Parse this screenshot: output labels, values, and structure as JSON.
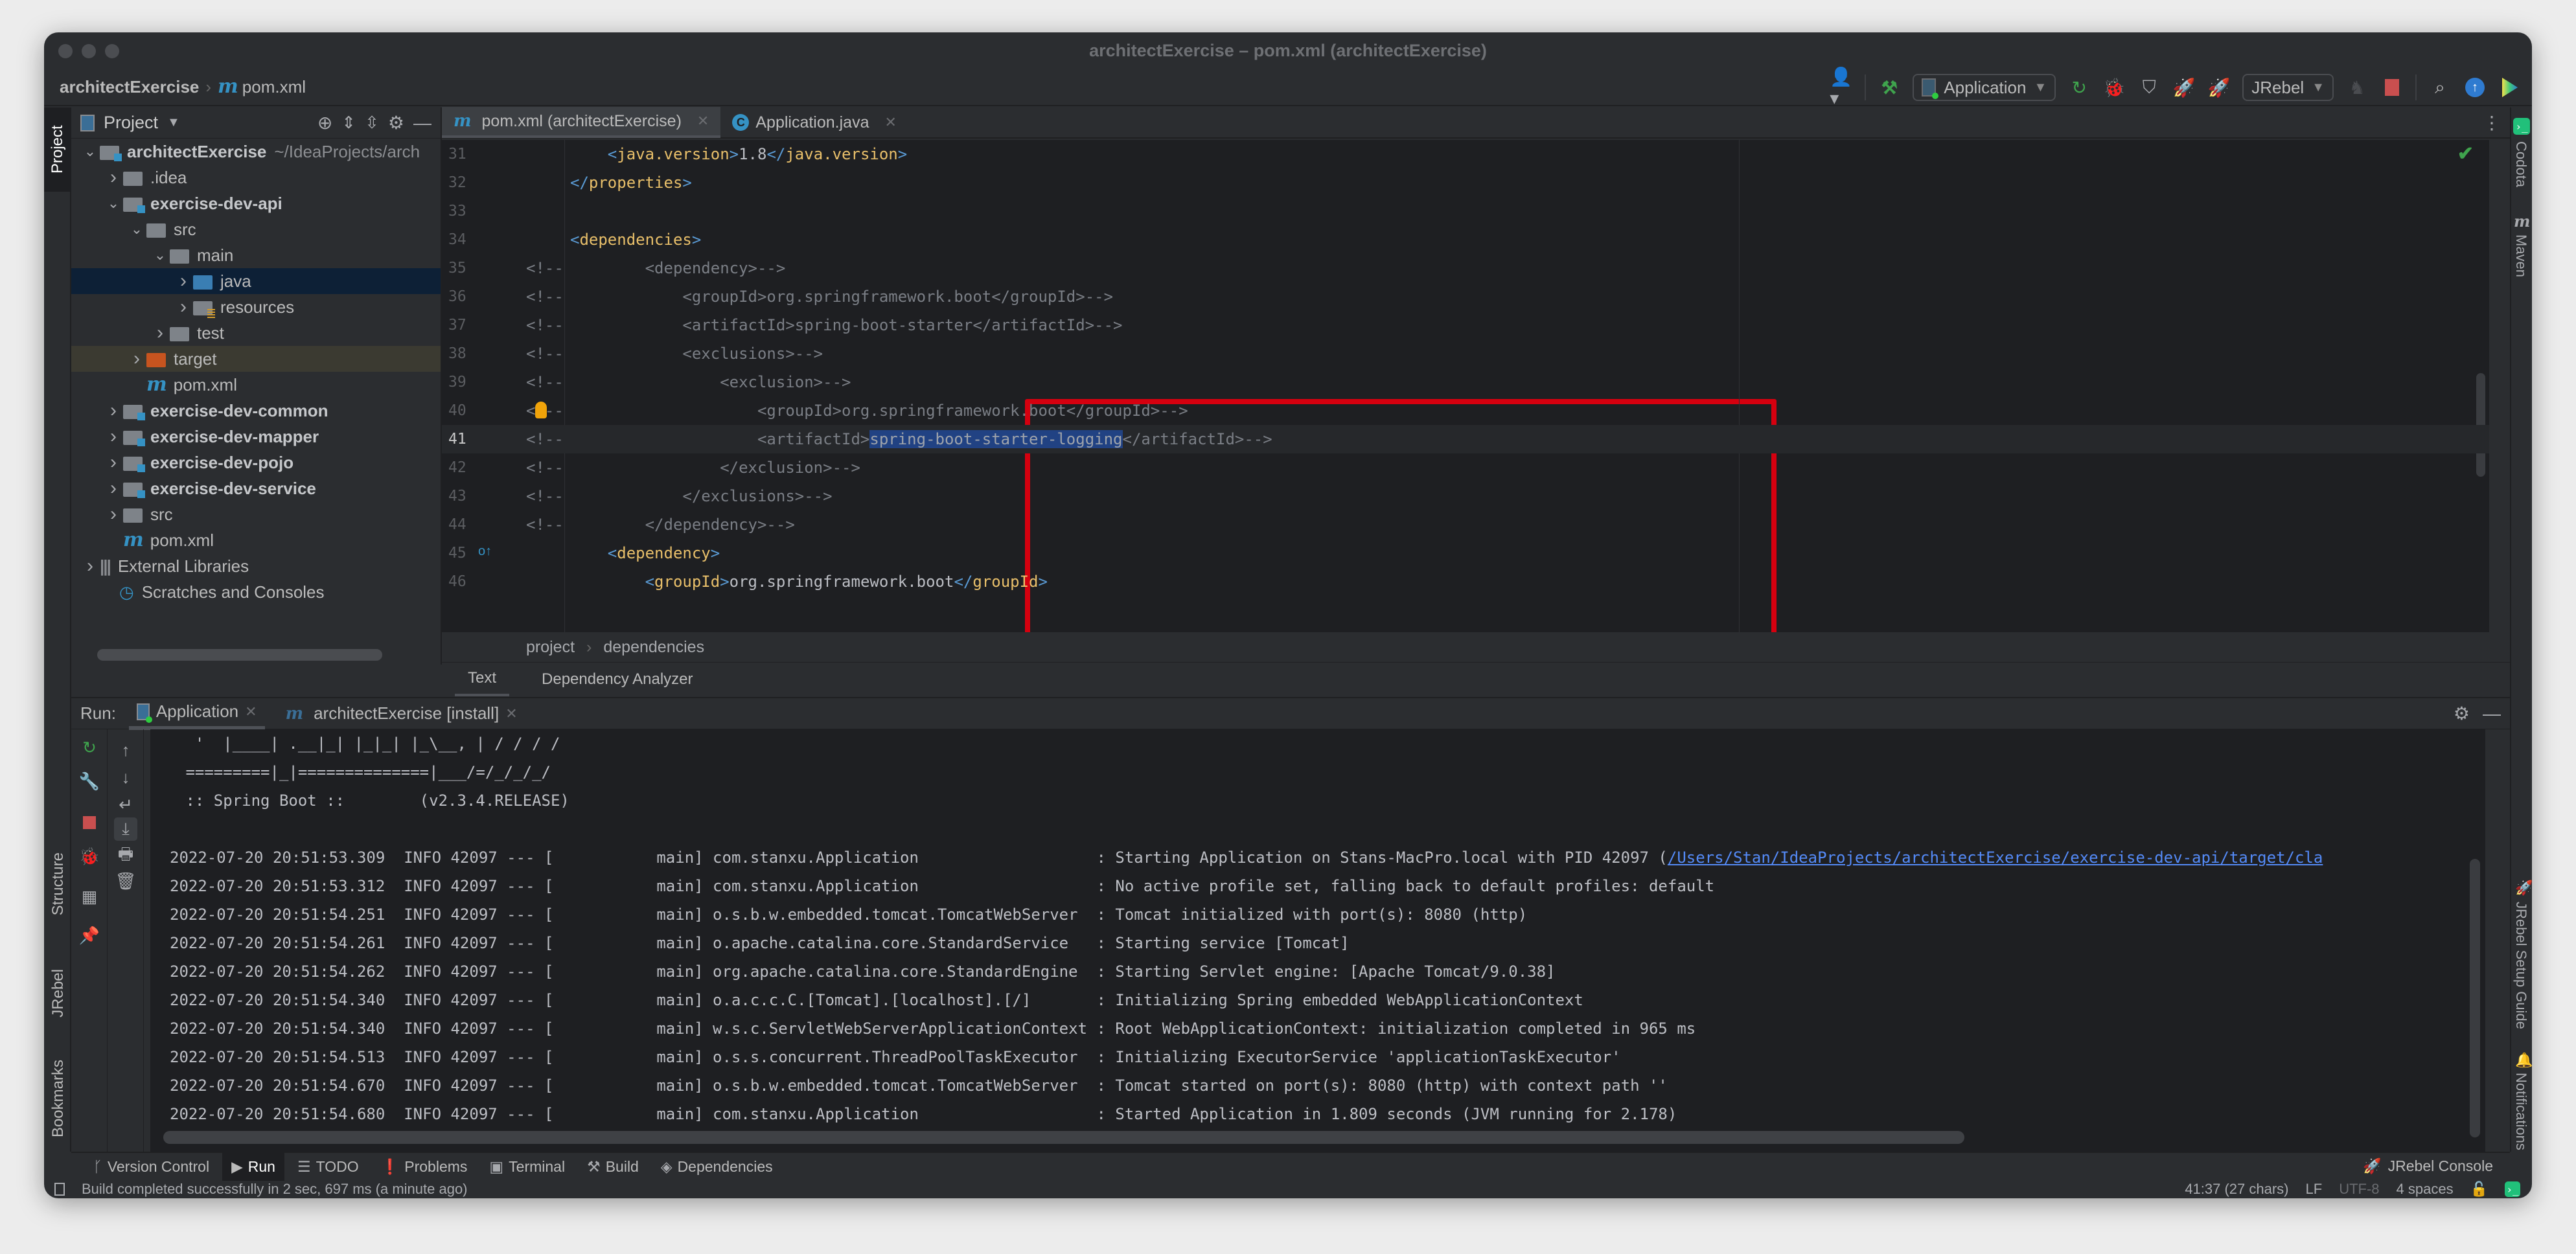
{
  "window": {
    "title": "architectExercise – pom.xml (architectExercise)"
  },
  "navbar": {
    "project": "architectExercise",
    "file": "pom.xml",
    "run_config": "Application",
    "jrebel_config": "JRebel"
  },
  "left_stripe": {
    "top": "Project",
    "structure": "Structure",
    "jrebel": "JRebel",
    "bookmarks": "Bookmarks"
  },
  "project_panel": {
    "title": "Project",
    "tree": [
      {
        "label": "architectExercise",
        "extra": "~/IdeaProjects/arch",
        "type": "module",
        "bold": true,
        "chevron": "open",
        "depth": 0
      },
      {
        "label": ".idea",
        "type": "folder",
        "chevron": "closed",
        "depth": 1
      },
      {
        "label": "exercise-dev-api",
        "type": "module",
        "bold": true,
        "chevron": "open",
        "depth": 1
      },
      {
        "label": "src",
        "type": "folder",
        "chevron": "open",
        "depth": 2
      },
      {
        "label": "main",
        "type": "folder",
        "chevron": "open",
        "depth": 3
      },
      {
        "label": "java",
        "type": "source",
        "chevron": "closed",
        "depth": 4,
        "state": "selected"
      },
      {
        "label": "resources",
        "type": "resources",
        "chevron": "closed",
        "depth": 4
      },
      {
        "label": "test",
        "type": "folder",
        "chevron": "closed",
        "depth": 3
      },
      {
        "label": "target",
        "type": "excluded",
        "chevron": "closed",
        "depth": 2,
        "state": "excluded"
      },
      {
        "label": "pom.xml",
        "type": "maven",
        "depth": 2
      },
      {
        "label": "exercise-dev-common",
        "type": "module",
        "bold": true,
        "chevron": "closed",
        "depth": 1
      },
      {
        "label": "exercise-dev-mapper",
        "type": "module",
        "bold": true,
        "chevron": "closed",
        "depth": 1
      },
      {
        "label": "exercise-dev-pojo",
        "type": "module",
        "bold": true,
        "chevron": "closed",
        "depth": 1
      },
      {
        "label": "exercise-dev-service",
        "type": "module",
        "bold": true,
        "chevron": "closed",
        "depth": 1
      },
      {
        "label": "src",
        "type": "folder",
        "chevron": "closed",
        "depth": 1
      },
      {
        "label": "pom.xml",
        "type": "maven",
        "depth": 1
      },
      {
        "label": "External Libraries",
        "type": "libraries",
        "chevron": "closed",
        "depth": 0
      },
      {
        "label": "Scratches and Consoles",
        "type": "scratches",
        "depth": 0
      }
    ]
  },
  "editor": {
    "tabs": [
      {
        "label": "pom.xml (architectExercise)",
        "icon": "maven-icon",
        "active": true
      },
      {
        "label": "Application.java",
        "icon": "java-class-icon",
        "active": false
      }
    ],
    "lines": [
      {
        "n": "31",
        "indent": "    ",
        "html": "java_version"
      },
      {
        "n": "32",
        "indent": ""
      },
      {
        "n": "33",
        "indent": ""
      },
      {
        "n": "34",
        "indent": ""
      },
      {
        "n": "35",
        "text": "    <dependency>-->"
      },
      {
        "n": "36",
        "text": "        <groupId>org.springframework.boot</groupId>-->"
      },
      {
        "n": "37",
        "text": "        <artifactId>spring-boot-starter</artifactId>-->"
      },
      {
        "n": "38",
        "text": "        <exclusions>-->"
      },
      {
        "n": "39",
        "text": "            <exclusion>-->"
      },
      {
        "n": "40",
        "text": "                <groupId>org.springframework.boot</groupId>-->"
      },
      {
        "n": "41",
        "pre": "                <artifactId>",
        "selected": "spring-boot-starter-logging",
        "post": "</artifactId>-->"
      },
      {
        "n": "42",
        "text": "            </exclusion>-->"
      },
      {
        "n": "43",
        "text": "        </exclusions>-->"
      },
      {
        "n": "44",
        "text": "    </dependency>-->"
      },
      {
        "n": "45"
      },
      {
        "n": "46"
      }
    ],
    "comment_prefix": "<!--",
    "java_version_tag": "java.version",
    "java_version_value": "1.8",
    "properties_tag": "properties",
    "dependencies_tag": "dependencies",
    "dependency_tag": "dependency",
    "groupId_tag": "groupId",
    "groupId_value": "org.springframework.boot",
    "breadcrumbs": [
      "project",
      "dependencies"
    ],
    "bottom_tabs": [
      "Text",
      "Dependency Analyzer"
    ],
    "active_bottom_tab": "Text"
  },
  "right_stripe": {
    "codota": "Codota",
    "maven": "Maven",
    "jrebel_setup": "JRebel Setup Guide",
    "notifications": "Notifications"
  },
  "run_panel": {
    "label": "Run:",
    "tabs": [
      {
        "label": "Application",
        "active": true
      },
      {
        "label": "architectExercise [install]",
        "active": false
      }
    ],
    "banner": [
      "  '  |____| .__|_| |_|_| |_\\__, | / / / /",
      " =========|_|==============|___/=/_/_/_/",
      " :: Spring Boot ::        (v2.3.4.RELEASE)"
    ],
    "logs": [
      {
        "time": "2022-07-20 20:51:53.309",
        "level": "INFO",
        "pid": "42097",
        "thread": "main",
        "logger": "com.stanxu.Application                  ",
        "msg": "Starting Application on Stans-MacPro.local with PID 42097 (",
        "link": "/Users/Stan/IdeaProjects/architectExercise/exercise-dev-api/target/cla"
      },
      {
        "time": "2022-07-20 20:51:53.312",
        "level": "INFO",
        "pid": "42097",
        "thread": "main",
        "logger": "com.stanxu.Application                  ",
        "msg": "No active profile set, falling back to default profiles: default"
      },
      {
        "time": "2022-07-20 20:51:54.251",
        "level": "INFO",
        "pid": "42097",
        "thread": "main",
        "logger": "o.s.b.w.embedded.tomcat.TomcatWebServer ",
        "msg": "Tomcat initialized with port(s): 8080 (http)"
      },
      {
        "time": "2022-07-20 20:51:54.261",
        "level": "INFO",
        "pid": "42097",
        "thread": "main",
        "logger": "o.apache.catalina.core.StandardService  ",
        "msg": "Starting service [Tomcat]"
      },
      {
        "time": "2022-07-20 20:51:54.262",
        "level": "INFO",
        "pid": "42097",
        "thread": "main",
        "logger": "org.apache.catalina.core.StandardEngine ",
        "msg": "Starting Servlet engine: [Apache Tomcat/9.0.38]"
      },
      {
        "time": "2022-07-20 20:51:54.340",
        "level": "INFO",
        "pid": "42097",
        "thread": "main",
        "logger": "o.a.c.c.C.[Tomcat].[localhost].[/]      ",
        "msg": "Initializing Spring embedded WebApplicationContext"
      },
      {
        "time": "2022-07-20 20:51:54.340",
        "level": "INFO",
        "pid": "42097",
        "thread": "main",
        "logger": "w.s.c.ServletWebServerApplicationContext",
        "msg": "Root WebApplicationContext: initialization completed in 965 ms"
      },
      {
        "time": "2022-07-20 20:51:54.513",
        "level": "INFO",
        "pid": "42097",
        "thread": "main",
        "logger": "o.s.s.concurrent.ThreadPoolTaskExecutor ",
        "msg": "Initializing ExecutorService 'applicationTaskExecutor'"
      },
      {
        "time": "2022-07-20 20:51:54.670",
        "level": "INFO",
        "pid": "42097",
        "thread": "main",
        "logger": "o.s.b.w.embedded.tomcat.TomcatWebServer ",
        "msg": "Tomcat started on port(s): 8080 (http) with context path ''"
      },
      {
        "time": "2022-07-20 20:51:54.680",
        "level": "INFO",
        "pid": "42097",
        "thread": "main",
        "logger": "com.stanxu.Application                  ",
        "msg": "Started Application in 1.809 seconds (JVM running for 2.178)"
      }
    ]
  },
  "tool_tabs": [
    {
      "label": "Version Control",
      "icon": "version-control-icon"
    },
    {
      "label": "Run",
      "icon": "run-icon",
      "active": true
    },
    {
      "label": "TODO",
      "icon": "todo-icon"
    },
    {
      "label": "Problems",
      "icon": "problems-icon"
    },
    {
      "label": "Terminal",
      "icon": "terminal-icon"
    },
    {
      "label": "Build",
      "icon": "build-icon"
    },
    {
      "label": "Dependencies",
      "icon": "dependencies-icon"
    }
  ],
  "jrebel_console": "JRebel Console",
  "statusbar": {
    "message": "Build completed successfully in 2 sec, 697 ms (a minute ago)",
    "position": "41:37 (27 chars)",
    "line_sep": "LF",
    "encoding": "UTF-8",
    "indent": "4 spaces"
  },
  "colors": {
    "accent_blue": "#3592c4",
    "selection": "#214283",
    "highlight_box": "#d5000f",
    "run_green": "#3fa34d",
    "stop_red": "#c94f4f",
    "xml_tag": "#e8bf6a",
    "link": "#548af7"
  }
}
